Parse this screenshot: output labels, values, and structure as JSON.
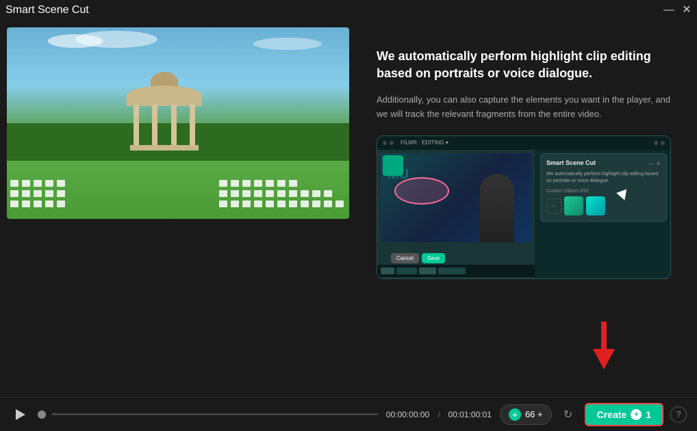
{
  "titlebar": {
    "title": "Smart Scene Cut",
    "minimize_label": "—",
    "close_label": "✕"
  },
  "right_panel": {
    "headline": "We automatically perform highlight clip editing based on portraits or voice dialogue.",
    "sub_text": "Additionally, you can also capture the elements you want in the player, and we will track the relevant fragments from the entire video."
  },
  "inner_dialog": {
    "title": "Smart Scene Cut",
    "description": "We automatically perform highlight clip editing based on portraits or voice dialogue.",
    "custom_object_label": "Custom Object  0/51",
    "cancel_label": "Cancel",
    "save_label": "Save"
  },
  "bottom_bar": {
    "play_tooltip": "Play",
    "time_current": "00:00:00:00",
    "time_divider": "/",
    "time_total": "00:01:00:01",
    "clips_count": "66",
    "clips_label": "66 +",
    "create_label": "Create",
    "create_count": "1",
    "help_label": "?"
  },
  "colors": {
    "accent": "#00c896",
    "bg_dark": "#1a1a1a",
    "bg_medium": "#222",
    "border": "#2a2a2a",
    "red_arrow": "#e02020",
    "create_border": "#ff4444"
  }
}
